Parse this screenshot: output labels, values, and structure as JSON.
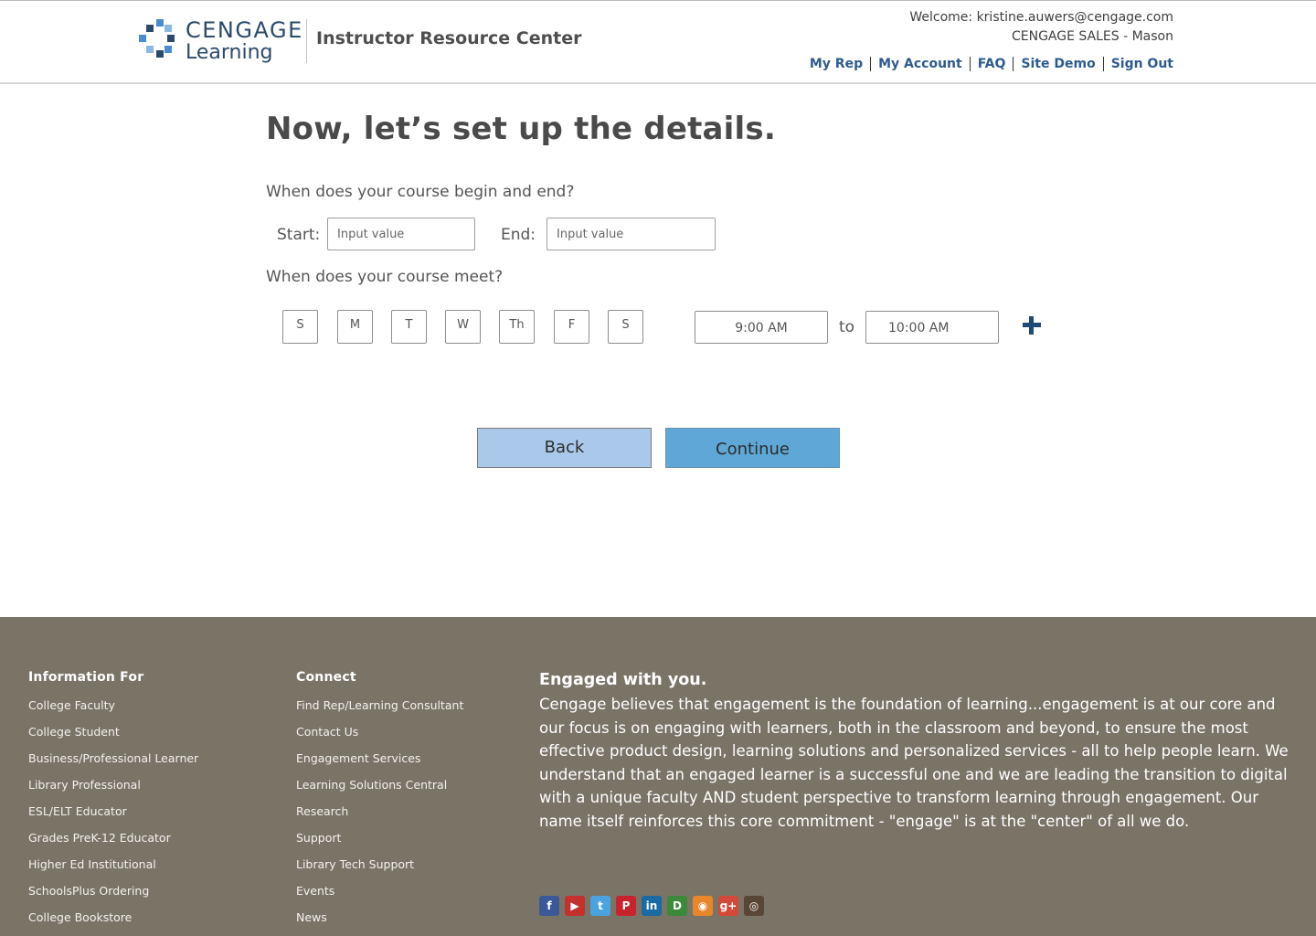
{
  "header": {
    "logo_top": "CENGAGE",
    "logo_bottom": "Learning",
    "title": "Instructor Resource Center",
    "welcome": "Welcome: kristine.auwers@cengage.com",
    "org": "CENGAGE SALES - Mason",
    "nav": [
      "My Rep",
      "My Account",
      "FAQ",
      "Site Demo",
      "Sign Out"
    ]
  },
  "main": {
    "title": "Now, let’s set up the details.",
    "question_dates": "When does your course begin and end?",
    "start_label": "Start:",
    "start_placeholder": "Input value",
    "end_label": "End:",
    "end_placeholder": "Input value",
    "question_meet": "When does your course meet?",
    "days": [
      "S",
      "M",
      "T",
      "W",
      "Th",
      "F",
      "S"
    ],
    "time_start": "9:00 AM",
    "to_label": "to",
    "time_end": "10:00 AM",
    "back_label": "Back",
    "continue_label": "Continue"
  },
  "colors": {
    "back_button": "#aac9ea",
    "continue_button": "#5fa7d6",
    "footer_bg": "#7a7467",
    "link": "#2e5b8f",
    "plus": "#1f4a78"
  },
  "footer": {
    "col1_title": "Information For",
    "col1_links": [
      "College Faculty",
      "College Student",
      "Business/Professional Learner",
      "Library Professional",
      "ESL/ELT Educator",
      "Grades PreK-12 Educator",
      "Higher Ed Institutional",
      "SchoolsPlus Ordering",
      "College Bookstore"
    ],
    "col2_title": "Connect",
    "col2_links": [
      "Find Rep/Learning Consultant",
      "Contact Us",
      "Engagement Services",
      "Learning Solutions Central",
      "Research",
      "Support",
      "Library Tech Support",
      "Events",
      "News"
    ],
    "engaged_title": "Engaged with you.",
    "engaged_text": "Cengage believes that engagement is the foundation of learning...engagement is at our core and our focus is on engaging with learners, both in the classroom and beyond, to ensure the most effective product design, learning solutions and personalized services - all to help people learn. We understand that an engaged learner is a successful one and we are leading the transition to digital with a unique faculty AND student perspective to transform learning through engagement. Our name itself reinforces this core commitment - \"engage\" is at the \"center\" of all we do.",
    "social": [
      {
        "icon": "facebook-icon",
        "glyph": "f",
        "color": "#3b5998"
      },
      {
        "icon": "youtube-icon",
        "glyph": "▶",
        "color": "#c4302b"
      },
      {
        "icon": "twitter-icon",
        "glyph": "t",
        "color": "#4aa3df"
      },
      {
        "icon": "pinterest-icon",
        "glyph": "P",
        "color": "#c8232c"
      },
      {
        "icon": "linkedin-icon",
        "glyph": "in",
        "color": "#1c6aa3"
      },
      {
        "icon": "delicious-icon",
        "glyph": "D",
        "color": "#3a8a3a"
      },
      {
        "icon": "rss-icon",
        "glyph": "◉",
        "color": "#e8862a"
      },
      {
        "icon": "google-plus-icon",
        "glyph": "g+",
        "color": "#d34836"
      },
      {
        "icon": "instagram-icon",
        "glyph": "◎",
        "color": "#5a4636"
      }
    ]
  }
}
